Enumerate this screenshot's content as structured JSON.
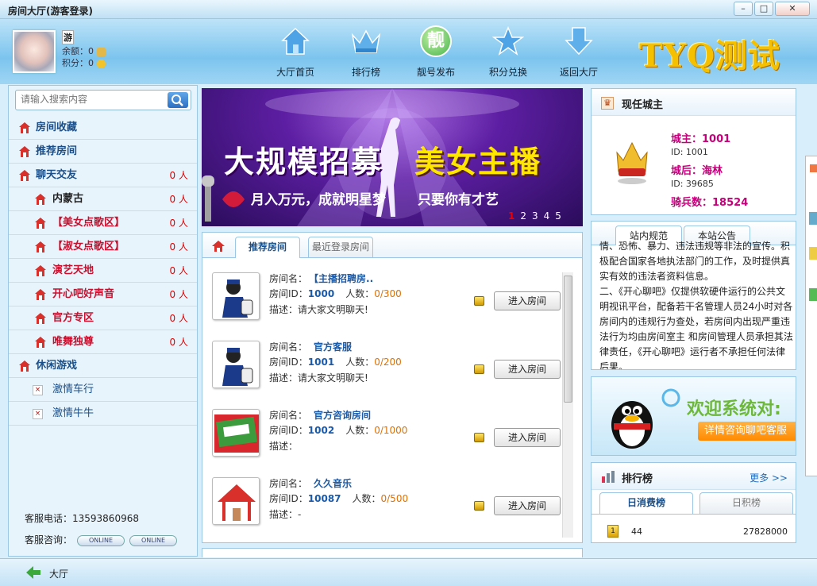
{
  "window": {
    "title": "房间大厅(游客登录)"
  },
  "user": {
    "level_char": "游",
    "balance_label": "余额：",
    "balance": "0",
    "points_label": "积分：",
    "points": "0"
  },
  "nav": [
    "大厅首页",
    "排行榜",
    "靓号发布",
    "积分兑换",
    "返回大厅"
  ],
  "nav_glyph_pretty": "靓",
  "logo": "TYQ测试",
  "search": {
    "placeholder": "请输入搜索内容"
  },
  "menu": [
    {
      "label": "房间收藏"
    },
    {
      "label": "推荐房间"
    },
    {
      "label": "聊天交友",
      "count": "0 人"
    },
    {
      "label": "内蒙古",
      "count": "0 人"
    },
    {
      "label": "【美女点歌区】",
      "count": "0 人"
    },
    {
      "label": "【淑女点歌区】",
      "count": "0 人"
    },
    {
      "label": "演艺天地",
      "count": "0 人"
    },
    {
      "label": "开心吧好声音",
      "count": "0 人"
    },
    {
      "label": "官方专区",
      "count": "0 人"
    },
    {
      "label": "唯舞独尊",
      "count": "0 人"
    },
    {
      "label": "休闲游戏"
    },
    {
      "label": "激情车行"
    },
    {
      "label": "激情牛牛"
    }
  ],
  "service": {
    "phone": "客服电话：13593860968",
    "consult": "客服咨询：",
    "online": "ONLINE"
  },
  "banner": {
    "line1": "大规模招募",
    "line2": "美女主播",
    "line3": "月入万元，成就明星梦",
    "line4": "只要你有才艺",
    "pages": [
      "1",
      "2",
      "3",
      "4",
      "5"
    ]
  },
  "room_tabs": [
    "推荐房间",
    "最近登录房间"
  ],
  "room_labels": {
    "name": "房间名：",
    "id": "房间ID：",
    "count": "人数：",
    "desc": "描述：",
    "enter": "进入房间"
  },
  "rooms": [
    {
      "name": "【主播招聘房..",
      "id": "1000",
      "count": "0/300",
      "desc": "请大家文明聊天!"
    },
    {
      "name": "官方客服",
      "id": "1001",
      "count": "0/200",
      "desc": "请大家文明聊天!"
    },
    {
      "name": "官方咨询房间",
      "id": "1002",
      "count": "0/1000",
      "desc": ""
    },
    {
      "name": "久久音乐",
      "id": "10087",
      "count": "0/500",
      "desc": "-"
    }
  ],
  "owner": {
    "title": "现任城主",
    "lord_label": "城主：",
    "lord": "1001",
    "lord_id": "ID: 1001",
    "queen_label": "城后：",
    "queen": "海林",
    "queen_id": "ID: 39685",
    "guards_label": "骑兵数：",
    "guards": "18524"
  },
  "notice": {
    "tabs": [
      "站内规范",
      "本站公告"
    ],
    "text": "情、恐怖、暴力、违法违规等非法的宣传。积极配合国家各地执法部门的工作，及时提供真实有效的违法者资料信息。\n二、《开心聊吧》仅提供软硬件运行的公共文明视讯平台，配备若干名管理人员24小时对各房间内的违规行为查处，若房间内出现严重违法行为均由房间室主 和房间管理人员承担其法律责任，《开心聊吧》运行者不承担任何法律后果。"
  },
  "promo": {
    "welcome": "欢迎系统对:",
    "consult": "详情咨询聊吧客服"
  },
  "rank": {
    "title": "排行榜",
    "more": "更多 >>",
    "tabs": [
      "日消费榜",
      "日积榜"
    ],
    "rows": [
      {
        "name": "44",
        "value": "27828000"
      }
    ]
  },
  "bottom": {
    "label": "大厅"
  }
}
